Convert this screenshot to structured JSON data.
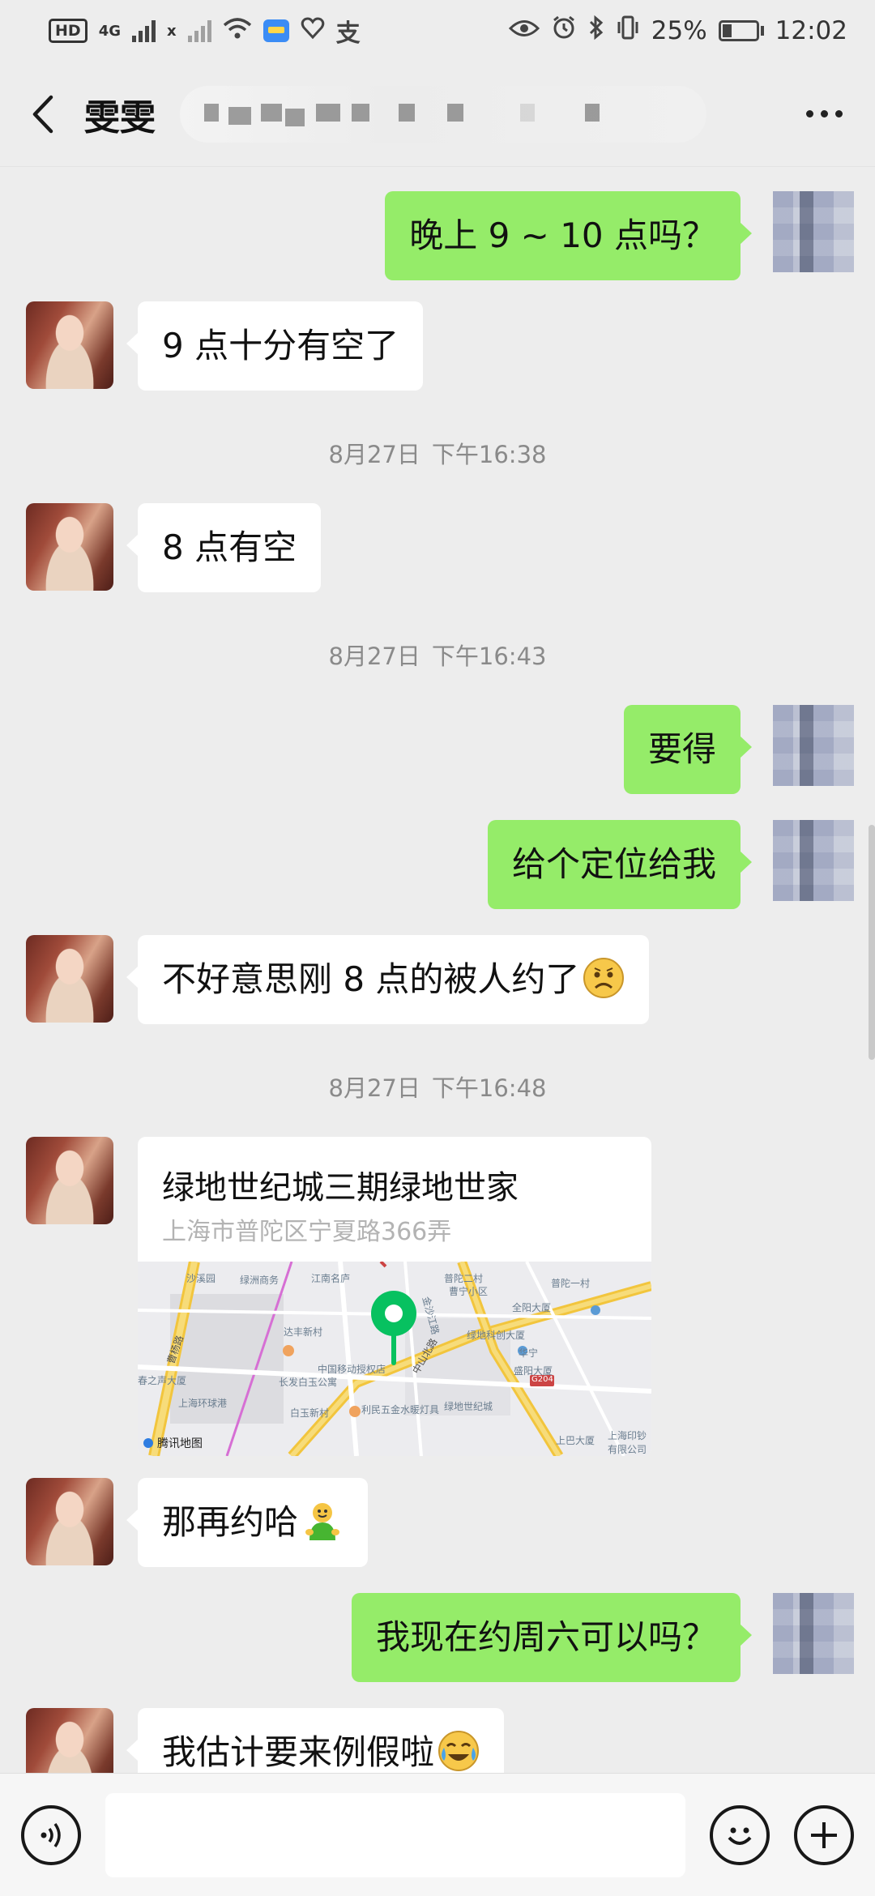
{
  "status_bar": {
    "hd": "HD",
    "sim1_tag": "4G",
    "sim2_tag": "x",
    "battery": "25%",
    "time": "12:02"
  },
  "header": {
    "title": "雯雯"
  },
  "messages": [
    {
      "side": "right",
      "text": "晚上 9 ~ 10 点吗？"
    },
    {
      "side": "left",
      "text": "9 点十分有空了"
    },
    {
      "type": "time",
      "date": "8月27日",
      "time": "下午16:38"
    },
    {
      "side": "left",
      "text": "8 点有空"
    },
    {
      "type": "time",
      "date": "8月27日",
      "time": "下午16:43"
    },
    {
      "side": "right",
      "text": "要得"
    },
    {
      "side": "right",
      "text": "给个定位给我"
    },
    {
      "side": "left",
      "text": "不好意思刚 8 点的被人约了",
      "emoji": "frown-emoji"
    },
    {
      "type": "time",
      "date": "8月27日",
      "time": "下午16:48"
    },
    {
      "side": "left",
      "type": "location",
      "title": "绿地世纪城三期绿地世家",
      "address": "上海市普陀区宁夏路366弄",
      "map_brand": "腾讯地图",
      "map_labels": [
        "沙溪园",
        "绿洲商务",
        "江南名庐",
        "普陀二村",
        "普陀一村",
        "曹宁小区",
        "全阳大厦",
        "金沙江路",
        "达丰新村",
        "绿地科创大厦",
        "中国移动授权店",
        "长发白玉公寓",
        "华宁",
        "盛阳大厦",
        "春之声大厦",
        "上海环球港",
        "白玉新村",
        "利民五金水暖灯具",
        "绿地世纪城",
        "上巴大厦",
        "上海印钞有限公司",
        "曹杨路",
        "中山北路",
        "G204"
      ]
    },
    {
      "side": "left",
      "text": "那再约哈",
      "emoji": "green-man-emoji"
    },
    {
      "side": "right",
      "text": "我现在约周六可以吗？"
    },
    {
      "side": "left",
      "text": "我估计要来例假啦",
      "emoji": "crying-laugh-emoji"
    }
  ],
  "input": {
    "value": ""
  },
  "colors": {
    "background": "#ededed",
    "my_bubble": "#95ec69",
    "their_bubble": "#ffffff",
    "map_pin": "#07c160"
  }
}
